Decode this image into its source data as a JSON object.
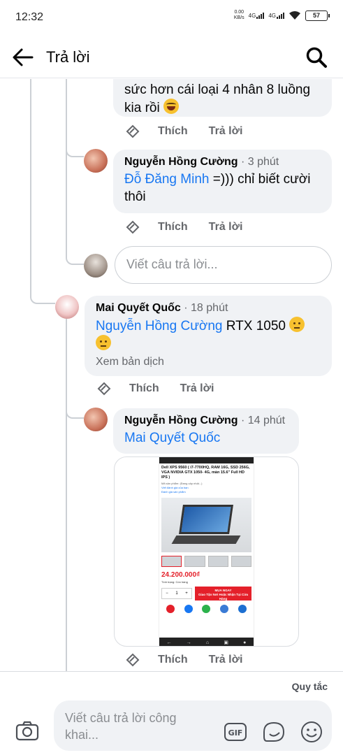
{
  "status_bar": {
    "time": "12:32",
    "speed_value": "0.00",
    "speed_unit": "KB/s",
    "net1": "4G",
    "net2": "4G",
    "battery": "57"
  },
  "header": {
    "title": "Trả lời",
    "back_icon": "arrow-left-icon",
    "search_icon": "search-icon"
  },
  "comments": [
    {
      "text_line1": "sức hơn cái loại 4 nhân 8 luồng",
      "text_line2": "kia rồi",
      "emoji": "rolling-laughing-emoji"
    },
    {
      "author": "Nguyễn Hồng Cường",
      "time": "· 3 phút",
      "mention": "Đỗ Đăng Minh",
      "text_after_mention": " =))) chỉ biết cười",
      "text_line2": "thôi"
    },
    {
      "author": "Mai Quyết Quốc",
      "time": "· 18 phút",
      "mention": "Nguyễn Hồng Cường",
      "text_after_mention": " RTX 1050",
      "emoji": "raised-eyebrow-emoji",
      "translate": "Xem bản dịch"
    },
    {
      "author": "Nguyễn Hồng Cường",
      "time": "· 14 phút",
      "mention": "Mai Quyết Quốc"
    }
  ],
  "actions": {
    "like": "Thích",
    "reply": "Trả lời"
  },
  "reply_box_placeholder": "Viết câu trả lời...",
  "attachment": {
    "product_title": "Dell XPS 9560 ( i7-7700HQ, RAM 16G, SSD 256G, VGA NVIDIA GTX 1050- 4G, màn 15.6\" Full HD IPS )",
    "product_code": "Mã sản phẩm: (Đang cập nhật...)",
    "review_link": "Viết đánh giá của bạn",
    "rating_link": "Đánh giá sản phẩm",
    "price": "24.200.000₫",
    "stock": "Tình trạng: Còn hàng",
    "buy_button": "MUA NGAY",
    "buy_sub": "Giao Tận Nơi Hoặc Nhận Tại Cửa Hàng"
  },
  "footer": {
    "rules": "Quy tắc",
    "composer_placeholder": "Viết câu trả lời công khai..."
  },
  "colors": {
    "link": "#1877f2",
    "bubble": "#f0f2f5",
    "secondary_text": "#65676b",
    "price_red": "#e4202a"
  }
}
